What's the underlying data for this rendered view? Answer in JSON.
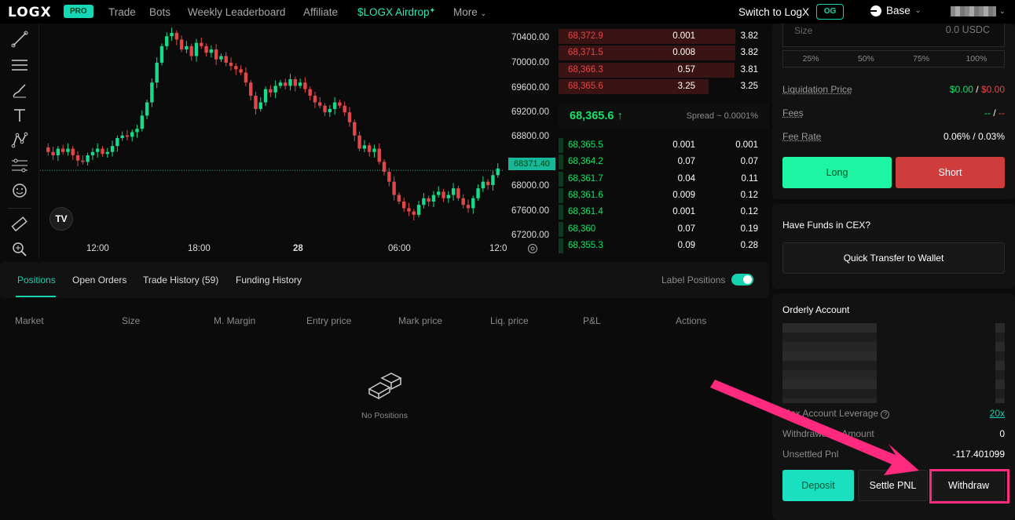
{
  "nav": {
    "logo": "LOGX",
    "badge": "PRO",
    "items": [
      "Trade",
      "Bots",
      "Weekly Leaderboard",
      "Affiliate"
    ],
    "airdrop": "$LOGX Airdrop",
    "more": "More",
    "switch": "Switch to LogX",
    "og": "OG",
    "network": "Base"
  },
  "chart": {
    "price_ticks": [
      "70400.00",
      "70000.00",
      "69600.00",
      "69200.00",
      "68800.00",
      "68000.00",
      "67600.00",
      "67200.00"
    ],
    "time_ticks": [
      "12:00",
      "18:00",
      "28",
      "06:00",
      "12:0"
    ],
    "last_price": "68371.40",
    "tv_logo": "TV"
  },
  "orderbook": {
    "asks": [
      {
        "price": "68,372.9",
        "size": "0.001",
        "total": "3.82"
      },
      {
        "price": "68,371.5",
        "size": "0.008",
        "total": "3.82"
      },
      {
        "price": "68,366.3",
        "size": "0.57",
        "total": "3.81"
      },
      {
        "price": "68,365.6",
        "size": "3.25",
        "total": "3.25"
      }
    ],
    "mid_price": "68,365.6 ↑",
    "spread": "Spread ~ 0.0001%",
    "bids": [
      {
        "price": "68,365.5",
        "size": "0.001",
        "total": "0.001"
      },
      {
        "price": "68,364.2",
        "size": "0.07",
        "total": "0.07"
      },
      {
        "price": "68,361.7",
        "size": "0.04",
        "total": "0.11"
      },
      {
        "price": "68,361.6",
        "size": "0.009",
        "total": "0.12"
      },
      {
        "price": "68,361.4",
        "size": "0.001",
        "total": "0.12"
      },
      {
        "price": "68,360",
        "size": "0.07",
        "total": "0.19"
      },
      {
        "price": "68,355.3",
        "size": "0.09",
        "total": "0.28"
      }
    ]
  },
  "positions": {
    "tabs": [
      "Positions",
      "Open Orders",
      "Trade History (59)",
      "Funding History"
    ],
    "label_positions": "Label Positions",
    "columns": [
      "Market",
      "Size",
      "M. Margin",
      "Entry price",
      "Mark price",
      "Liq. price",
      "P&L",
      "Actions"
    ],
    "empty": "No Positions"
  },
  "order_form": {
    "size_label": "Size",
    "size_value": "0.0 USDC",
    "percents": [
      "25%",
      "50%",
      "75%",
      "100%"
    ],
    "liq_label": "Liquidation Price",
    "liq_long": "$0.00",
    "liq_sep": "/",
    "liq_short": "$0.00",
    "fees_label": "Fees",
    "fees_long": "--",
    "fees_sep": "/",
    "fees_short": "--",
    "fee_rate_label": "Fee Rate",
    "fee_rate": "0.06% / 0.03%",
    "long": "Long",
    "short": "Short"
  },
  "cex": {
    "title": "Have Funds in CEX?",
    "button": "Quick Transfer to Wallet"
  },
  "account": {
    "title": "Orderly Account",
    "max_leverage_label": "Max Account Leverage",
    "max_leverage": "20x",
    "withdrawable_label": "Withdrawable Amount",
    "withdrawable": "0",
    "unsettled_label": "Unsettled Pnl",
    "unsettled": "-117.401099",
    "deposit": "Deposit",
    "settle": "Settle PNL",
    "withdraw": "Withdraw"
  },
  "colors": {
    "accent": "#16d3b0",
    "up": "#17e26b",
    "down": "#e04848",
    "highlight": "#ff2a7d"
  }
}
